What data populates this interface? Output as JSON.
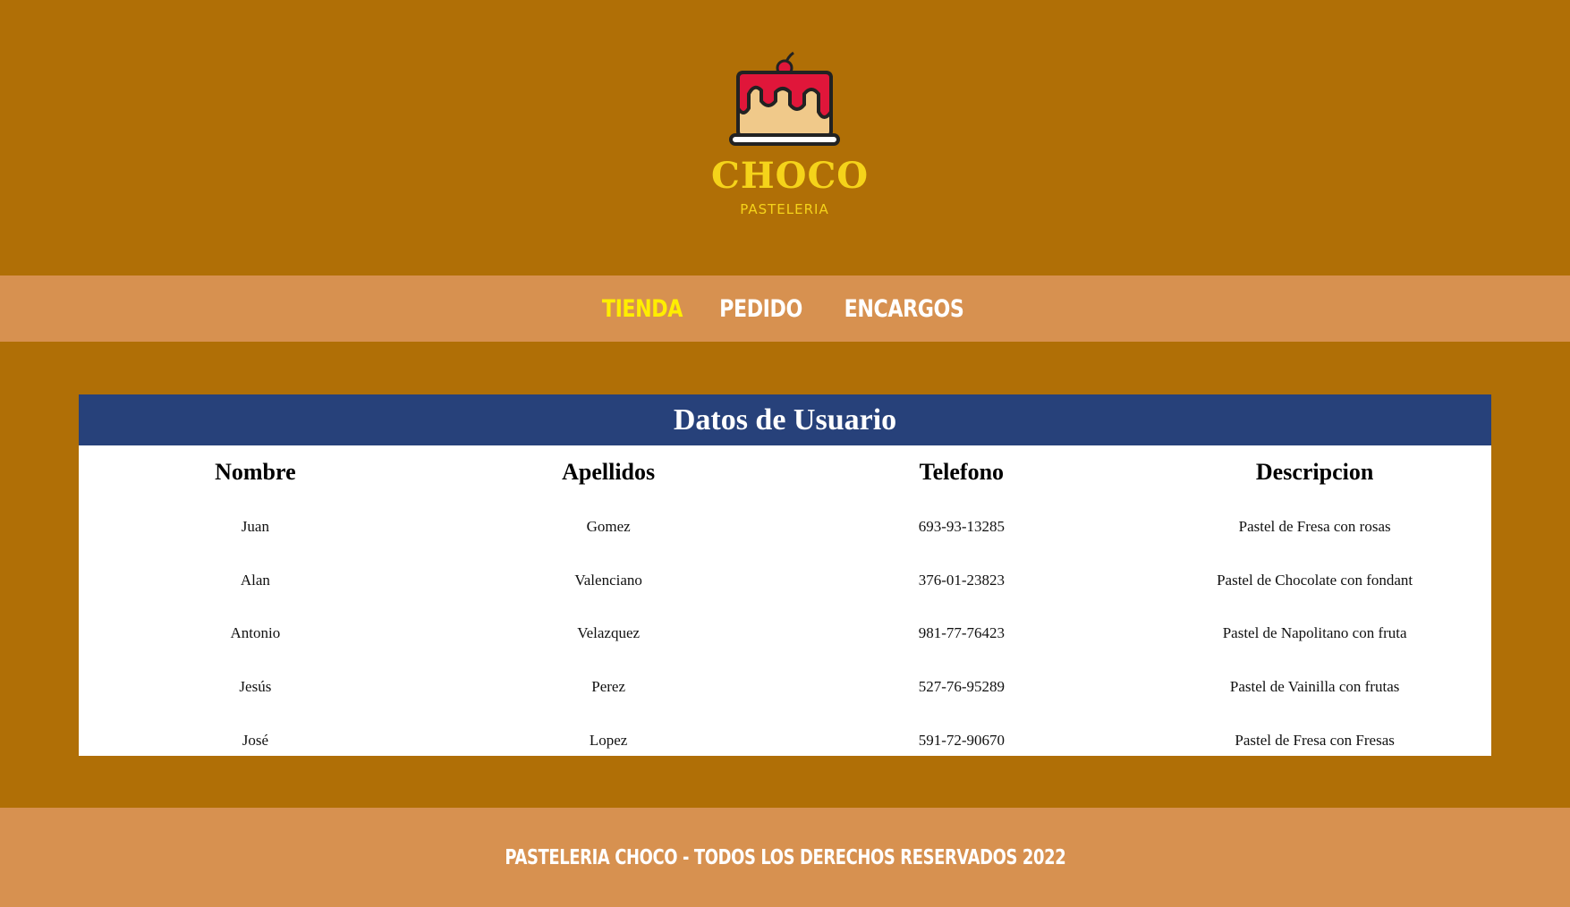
{
  "brand": {
    "name": "CHOCO",
    "subtitle": "PASTELERIA",
    "logo_icon": "cake-icon"
  },
  "nav": {
    "items": [
      {
        "label": "TIENDA",
        "active": true
      },
      {
        "label": "PEDIDO",
        "active": false
      },
      {
        "label": "ENCARGOS",
        "active": false
      }
    ]
  },
  "table": {
    "title": "Datos de Usuario",
    "headers": [
      "Nombre",
      "Apellidos",
      "Telefono",
      "Descripcion"
    ],
    "rows": [
      [
        "Juan",
        "Gomez",
        "693-93-13285",
        "Pastel de Fresa con rosas"
      ],
      [
        "Alan",
        "Valenciano",
        "376-01-23823",
        "Pastel de Chocolate con fondant"
      ],
      [
        "Antonio",
        "Velazquez",
        "981-77-76423",
        "Pastel de Napolitano con fruta"
      ],
      [
        "Jesús",
        "Perez",
        "527-76-95289",
        "Pastel de Vainilla con frutas"
      ],
      [
        "José",
        "Lopez",
        "591-72-90670",
        "Pastel de Fresa con Fresas"
      ]
    ]
  },
  "footer": {
    "text": "PASTELERIA CHOCO - TODOS LOS DERECHOS RESERVADOS 2022"
  },
  "colors": {
    "background": "#b06f06",
    "bar": "#d79150",
    "table_header": "#27417a",
    "brand": "#f5d31a",
    "nav_active": "#ffee00"
  }
}
